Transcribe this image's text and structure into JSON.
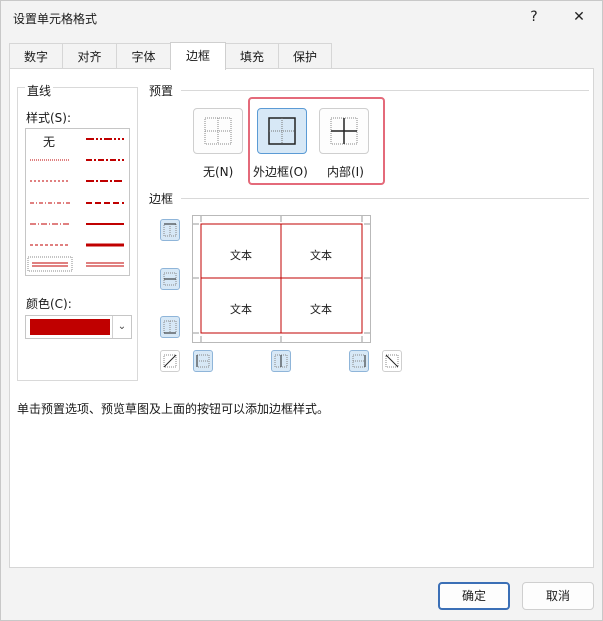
{
  "dialog": {
    "title": "设置单元格格式",
    "help_icon": "?",
    "close_icon": "✕"
  },
  "tabs": [
    {
      "label": "数字"
    },
    {
      "label": "对齐"
    },
    {
      "label": "字体"
    },
    {
      "label": "边框",
      "active": true
    },
    {
      "label": "填充"
    },
    {
      "label": "保护"
    }
  ],
  "line": {
    "section_label": "直线",
    "style_label": "样式(S):",
    "none_label": "无",
    "color_label": "颜色(C):",
    "selected_color": "#c00000"
  },
  "presets": {
    "section_label": "预置",
    "items": [
      {
        "label": "无(N)"
      },
      {
        "label": "外边框(O)",
        "selected": true
      },
      {
        "label": "内部(I)"
      }
    ]
  },
  "border": {
    "section_label": "边框",
    "preview_cells": [
      "文本",
      "文本",
      "文本",
      "文本"
    ]
  },
  "hint": "单击预置选项、预览草图及上面的按钮可以添加边框样式。",
  "buttons": {
    "ok": "确定",
    "cancel": "取消"
  },
  "colors": {
    "border_red": "#c00000",
    "highlight": "#e46a7a",
    "selected_bg": "#d7e8f6"
  }
}
